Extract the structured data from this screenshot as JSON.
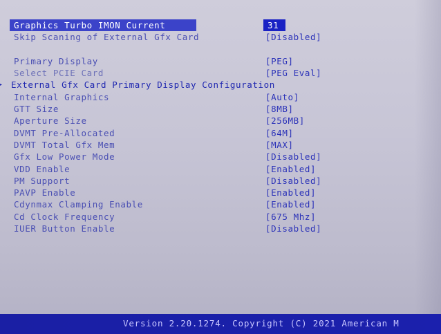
{
  "settings": [
    {
      "label": "Graphics Turbo IMON Current",
      "value": "31"
    },
    {
      "label": "Skip Scaning of External Gfx Card",
      "value": "[Disabled]"
    },
    {
      "label": "Primary Display",
      "value": "[PEG]"
    },
    {
      "label": "Select PCIE Card",
      "value": "[PEG Eval]"
    },
    {
      "label": "External Gfx Card Primary Display Configuration",
      "value": ""
    },
    {
      "label": "Internal Graphics",
      "value": "[Auto]"
    },
    {
      "label": "GTT Size",
      "value": "[8MB]"
    },
    {
      "label": "Aperture Size",
      "value": "[256MB]"
    },
    {
      "label": "DVMT Pre-Allocated",
      "value": "[64M]"
    },
    {
      "label": "DVMT Total Gfx Mem",
      "value": "[MAX]"
    },
    {
      "label": "Gfx Low Power Mode",
      "value": "[Disabled]"
    },
    {
      "label": "VDD Enable",
      "value": "[Enabled]"
    },
    {
      "label": "PM Support",
      "value": "[Disabled]"
    },
    {
      "label": "PAVP Enable",
      "value": "[Enabled]"
    },
    {
      "label": "Cdynmax Clamping Enable",
      "value": "[Enabled]"
    },
    {
      "label": "Cd Clock Frequency",
      "value": "[675 Mhz]"
    },
    {
      "label": "IUER Button Enable",
      "value": "[Disabled]"
    }
  ],
  "footer": {
    "version": "Version 2.20.1274. Copyright (C) 2021 American M"
  }
}
